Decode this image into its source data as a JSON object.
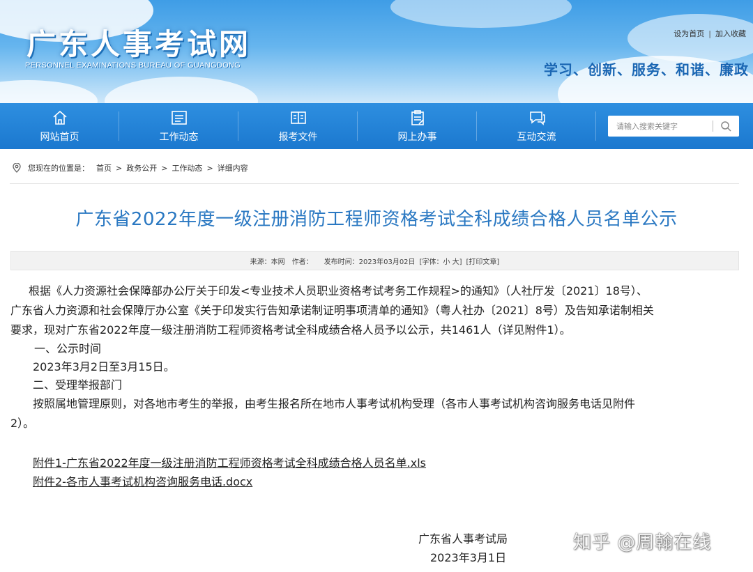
{
  "header": {
    "site_title": "广东人事考试网",
    "site_subtitle": "PERSONNEL EXAMINATIONS BUREAU OF GUANGDONG",
    "top_links": {
      "set_home": "设为首页",
      "separator": "|",
      "bookmark": "加入收藏"
    },
    "slogan": "学习、创新、服务、和谐、廉政"
  },
  "nav": {
    "items": [
      {
        "label": "网站首页",
        "icon": "home-icon"
      },
      {
        "label": "工作动态",
        "icon": "news-icon"
      },
      {
        "label": "报考文件",
        "icon": "book-icon"
      },
      {
        "label": "网上办事",
        "icon": "clipboard-icon"
      },
      {
        "label": "互动交流",
        "icon": "chat-icon"
      }
    ],
    "search": {
      "placeholder": "请输入搜索关键字",
      "icon": "search-icon"
    }
  },
  "breadcrumb": {
    "prefix": "您现在的位置是：",
    "items": [
      "首页",
      "政务公开",
      "工作动态",
      "详细内容"
    ],
    "arrow": ">"
  },
  "article": {
    "title": "广东省2022年度一级注册消防工程师资格考试全科成绩合格人员名单公示",
    "meta": {
      "source": "来源：本网",
      "author": "作者：",
      "published": "发布时间：2023年03月02日",
      "font_size": "[字体：小 大]",
      "print": "[打印文章]"
    },
    "paragraph1": [
      "根据《人力资源社会保障部办公厅关于印发<专业技术人员职业资格考试考务工作规程>的通知》（人社厅发〔2021〕18号）、",
      "广东省人力资源和社会保障厅办公室《关于印发实行告知承诺制证明事项清单的通知》（粤人社办〔2021〕8号）及告知承诺制相关",
      "要求，现对广东省2022年度一级注册消防工程师资格考试全科成绩合格人员予以公示，共1461人（详见附件1）。"
    ],
    "section1_heading": "一、公示时间",
    "section1_text": "2023年3月2日至3月15日。",
    "section2_heading": "二、受理举报部门",
    "section2_text": [
      "按照属地管理原则，对各地市考生的举报，由考生报名所在地市人事考试机构受理（各市人事考试机构咨询服务电话见附件",
      "2）。"
    ],
    "attachments": [
      "附件1-广东省2022年度一级注册消防工程师资格考试全科成绩合格人员名单.xls",
      "附件2-各市人事考试机构咨询服务电话.docx"
    ],
    "signature": {
      "org": "广东省人事考试局",
      "date": "2023年3月1日"
    }
  },
  "watermark": "知乎 @周翰在线",
  "colors": {
    "nav_bg": "#1b78cf",
    "title_blue": "#2a78c2",
    "slogan_blue": "#1a66b3"
  }
}
